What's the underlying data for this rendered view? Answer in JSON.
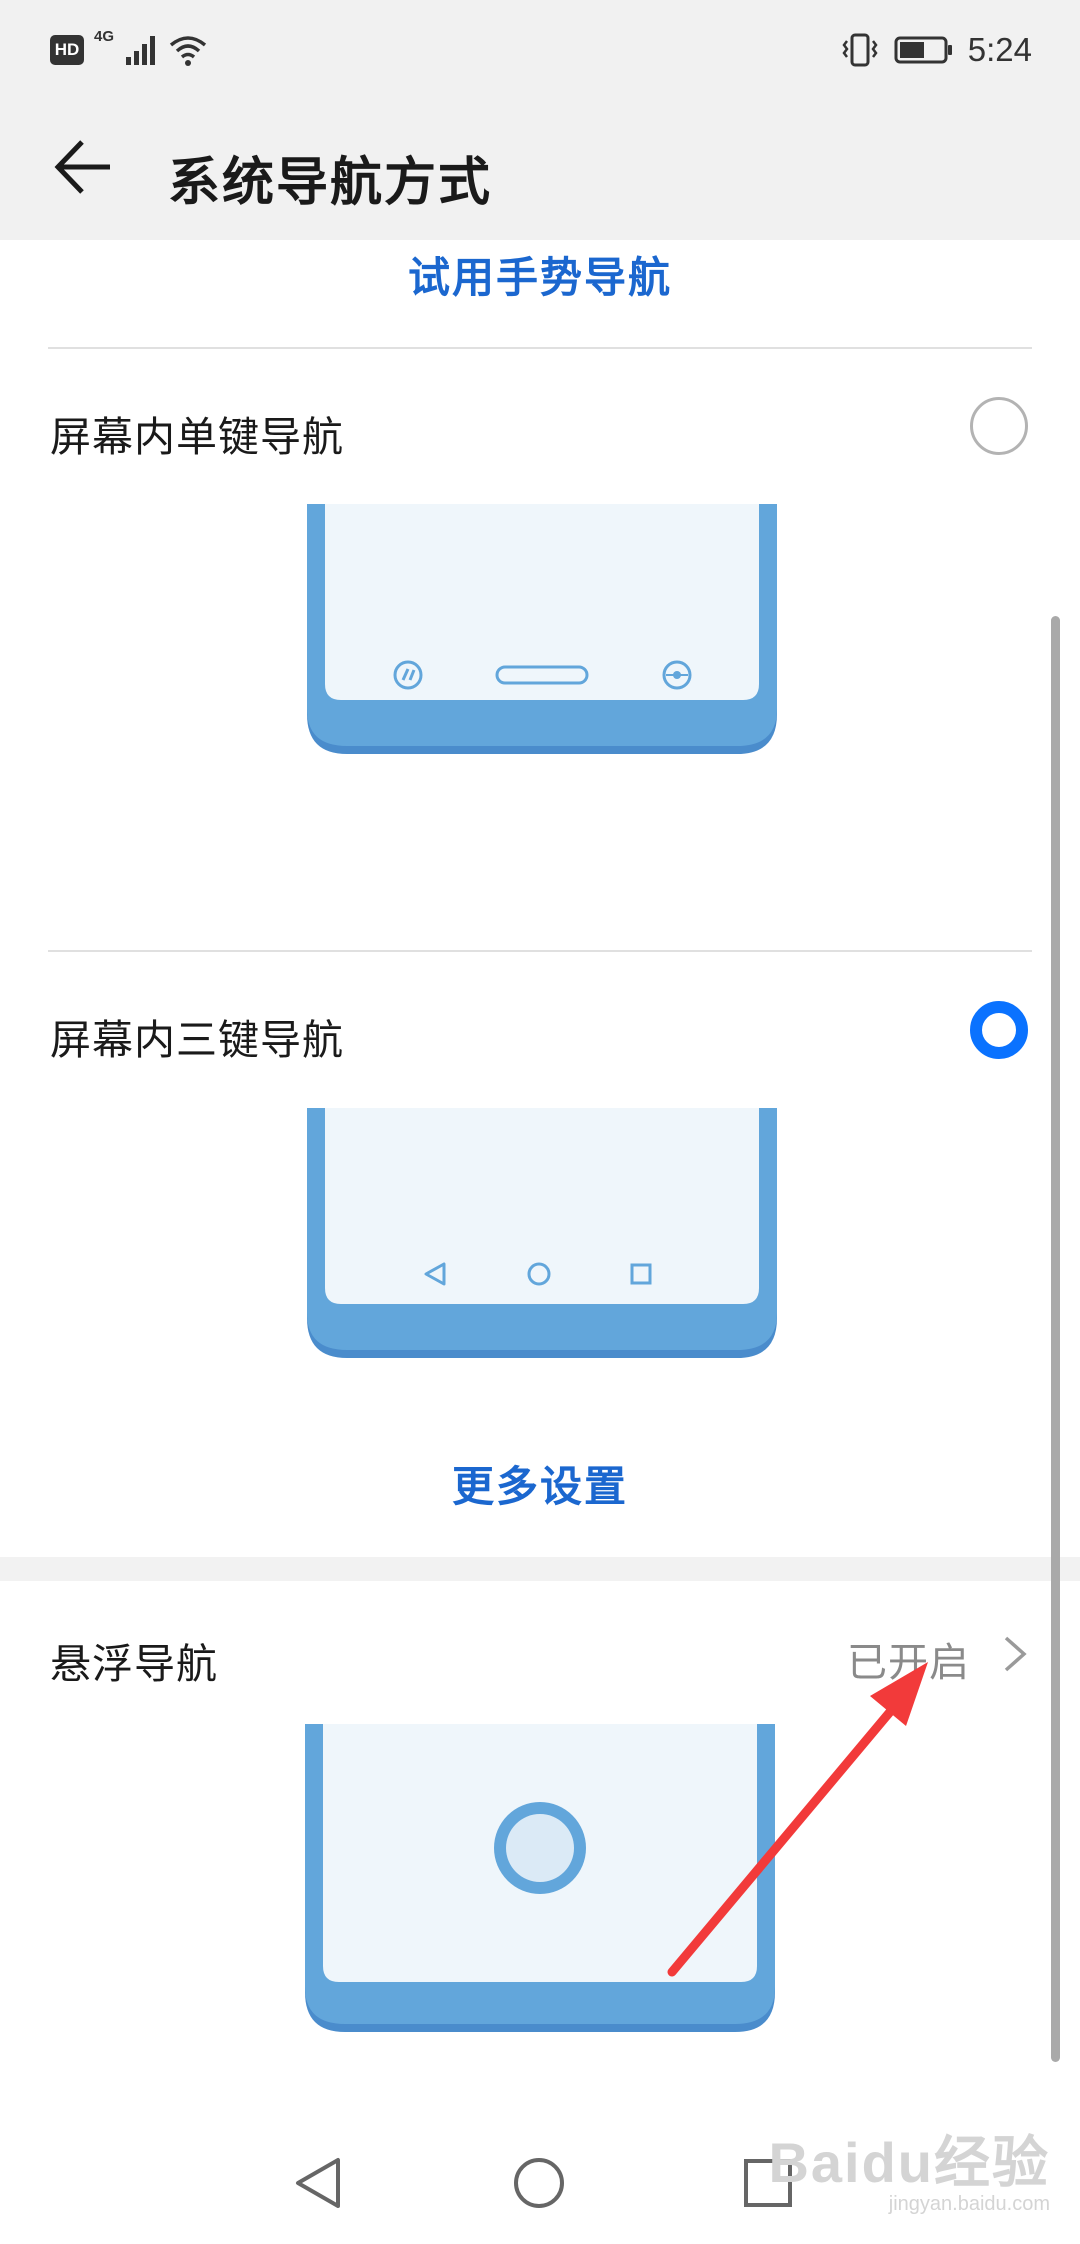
{
  "status_bar": {
    "hd_badge": "HD",
    "network_type": "4G",
    "time": "5:24",
    "icons": [
      "hd-icon",
      "signal-icon",
      "wifi-icon",
      "vibrate-icon",
      "battery-icon"
    ]
  },
  "header": {
    "back_icon": "arrow-left-icon",
    "title": "系统导航方式"
  },
  "gesture_try_link": "试用手势导航",
  "options": [
    {
      "label": "屏幕内单键导航",
      "selected": false
    },
    {
      "label": "屏幕内三键导航",
      "selected": true
    }
  ],
  "more_settings_link": "更多设置",
  "floating_nav": {
    "label": "悬浮导航",
    "status": "已开启"
  },
  "nav_bar": {
    "icons": [
      "back-triangle-icon",
      "home-circle-icon",
      "recents-square-icon"
    ]
  },
  "watermark": {
    "main": "Baidu经验",
    "sub": "jingyan.baidu.com"
  },
  "colors": {
    "accent": "#1b67cf",
    "radio_selected": "#0a72ff",
    "phone_frame": "#62a6db",
    "phone_screen": "#eff6fb",
    "annotation_arrow": "#f23a3a"
  }
}
